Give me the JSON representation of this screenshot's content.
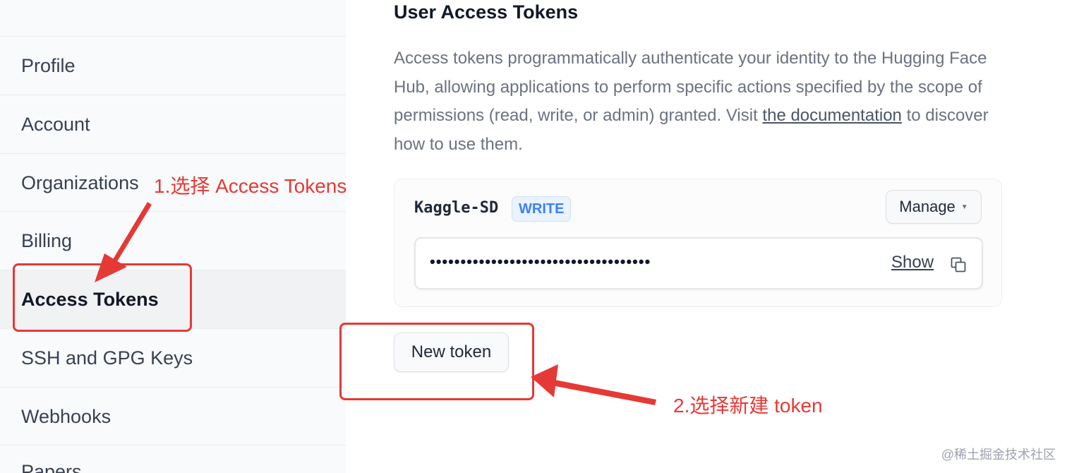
{
  "sidebar": {
    "items": [
      {
        "label": "Profile"
      },
      {
        "label": "Account"
      },
      {
        "label": "Organizations"
      },
      {
        "label": "Billing"
      },
      {
        "label": "Access Tokens",
        "active": true
      },
      {
        "label": "SSH and GPG Keys"
      },
      {
        "label": "Webhooks"
      },
      {
        "label": "Papers"
      }
    ]
  },
  "main": {
    "title": "User Access Tokens",
    "description": {
      "text_before": "Access tokens programmatically authenticate your identity to the Hugging Face Hub, allowing applications to perform specific actions specified by the scope of permissions (read, write, or admin) granted. Visit ",
      "link": "the documentation",
      "text_after": " to discover how to use them."
    },
    "token": {
      "name": "Kaggle-SD",
      "role": "WRITE",
      "manage_label": "Manage",
      "secret_masked": "••••••••••••••••••••••••••••••••••••",
      "show_label": "Show"
    },
    "new_token_label": "New token"
  },
  "annotations": {
    "step1": "1.选择 Access Tokens",
    "step2": "2.选择新建 token",
    "color": "#e53935"
  },
  "watermark": "@稀土掘金技术社区",
  "icons": {
    "copy": "copy-icon",
    "manage_caret": "caret-down-icon"
  }
}
